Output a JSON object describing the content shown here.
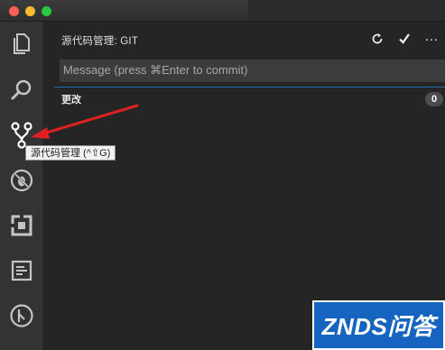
{
  "sidebar": {
    "title": "源代码管理: GIT",
    "actions": {
      "refresh_icon": "refresh-icon",
      "commit_icon": "checkmark-icon",
      "more_label": "···"
    },
    "commit_message": {
      "placeholder": "Message (press ⌘Enter to commit)"
    },
    "changes": {
      "label": "更改",
      "count": "0"
    }
  },
  "activity_bar": {
    "items": [
      {
        "icon": "explorer-icon"
      },
      {
        "icon": "search-icon"
      },
      {
        "icon": "source-control-icon",
        "active": true
      },
      {
        "icon": "debug-icon"
      },
      {
        "icon": "extensions-icon"
      },
      {
        "icon": "output-icon"
      },
      {
        "icon": "git-icon"
      }
    ]
  },
  "tooltip": {
    "text": "源代码管理 (^⇧G)"
  },
  "watermark": {
    "text": "ZNDS问答"
  },
  "colors": {
    "activity_bar": "#333333",
    "sidebar": "#252526",
    "input": "#3c3c3c",
    "focus": "#1f6fa3",
    "arrow": "#e02020",
    "watermark": "#1565c0"
  }
}
